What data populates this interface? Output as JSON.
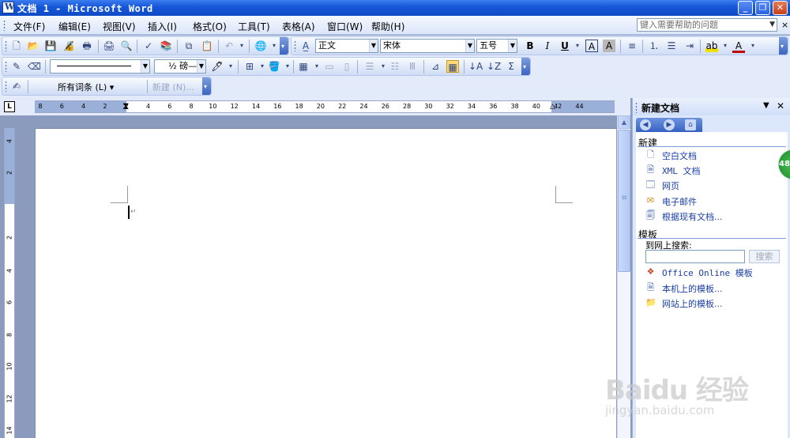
{
  "titlebar": {
    "title": "文档 1 - Microsoft Word",
    "minimize": "_",
    "restore": "❐",
    "close": "✕"
  },
  "menubar": {
    "items": [
      "文件(F)",
      "编辑(E)",
      "视图(V)",
      "插入(I)",
      "格式(O)",
      "工具(T)",
      "表格(A)",
      "窗口(W)",
      "帮助(H)"
    ],
    "help_placeholder": "键入需要帮助的问题",
    "close_doc": "×"
  },
  "formatting": {
    "style": "正文",
    "font": "宋体",
    "size": "五号"
  },
  "drawing": {
    "line_weight": "½ 磅—"
  },
  "reviewing": {
    "markup": "所有词条 (L) ▾",
    "new": "新建 (N)..."
  },
  "ruler": {
    "corner": "L",
    "h_ticks": [
      "8",
      "6",
      "4",
      "2",
      "2",
      "4",
      "6",
      "8",
      "10",
      "12",
      "14",
      "16",
      "18",
      "20",
      "22",
      "24",
      "26",
      "28",
      "30",
      "32",
      "34",
      "36",
      "38",
      "40",
      "42",
      "44"
    ],
    "v_ticks": [
      "4",
      "2",
      "2",
      "4",
      "6",
      "8",
      "10",
      "12",
      "14"
    ]
  },
  "taskpane": {
    "title": "新建文档",
    "section_new": "新建",
    "new_links": [
      {
        "icon": "blank-doc-icon",
        "label": "空白文档"
      },
      {
        "icon": "xml-doc-icon",
        "label": "XML 文档"
      },
      {
        "icon": "web-page-icon",
        "label": "网页"
      },
      {
        "icon": "email-icon",
        "label": "电子邮件"
      },
      {
        "icon": "existing-doc-icon",
        "label": "根据现有文档..."
      }
    ],
    "section_templates": "模板",
    "search_label": "到网上搜索:",
    "search_button": "搜索",
    "template_links": [
      {
        "icon": "office-online-icon",
        "label": "Office Online 模板"
      },
      {
        "icon": "local-template-icon",
        "label": "本机上的模板..."
      },
      {
        "icon": "website-template-icon",
        "label": "网站上的模板..."
      }
    ],
    "badge": "48"
  },
  "watermark": {
    "logo": "Baidu 经验",
    "url": "jingyan.baidu.com"
  }
}
